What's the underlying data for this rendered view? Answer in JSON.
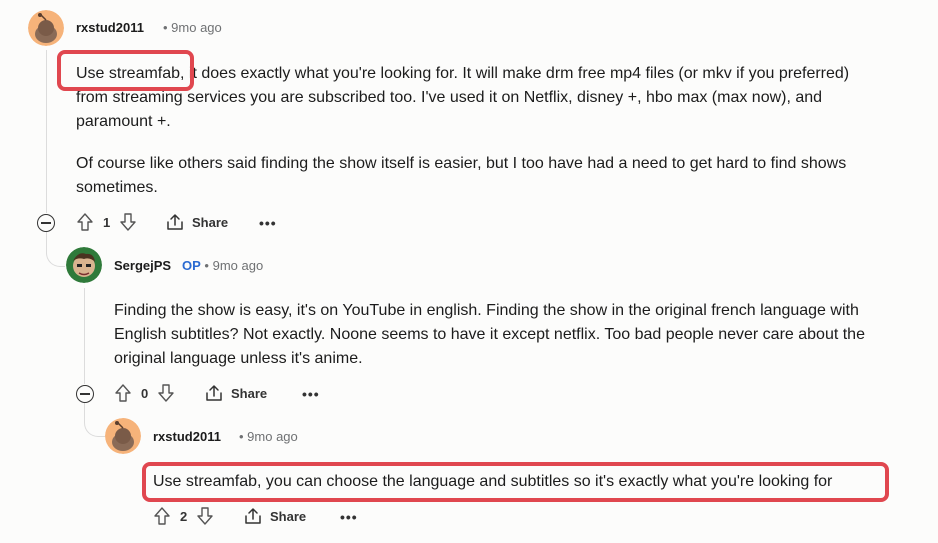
{
  "comments": [
    {
      "author": "rxstud2011",
      "time": "• 9mo ago",
      "paragraph1_lines": [
        "Use streamfab, it does exactly what you're looking for. It will make drm free mp4 files (or mkv if you preferred)",
        "from streaming services you are subscribed too. I've used it on Netflix, disney +, hbo max (max now), and",
        "paramount +."
      ],
      "paragraph2_lines": [
        "Of course like others said finding the show itself is easier, but I too have had a need to get hard to find shows",
        "sometimes."
      ],
      "votes": "1",
      "share_label": "Share",
      "more_label": "•••"
    },
    {
      "author": "SergejPS",
      "op_badge": "OP",
      "time": "• 9mo ago",
      "paragraph1_lines": [
        "Finding the show is easy, it's on YouTube in english. Finding the show in the original french language with",
        "English subtitles? Not exactly. Noone seems to have it except netflix. Too bad people never care about the",
        "original language unless it's anime."
      ],
      "votes": "0",
      "share_label": "Share",
      "more_label": "•••"
    },
    {
      "author": "rxstud2011",
      "time": "• 9mo ago",
      "paragraph1_lines": [
        "Use streamfab, you can choose the language and subtitles so it's exactly what you're looking for"
      ],
      "votes": "2",
      "share_label": "Share",
      "more_label": "•••"
    }
  ],
  "colors": {
    "highlight": "#e0474f",
    "op": "#2a6ad1",
    "meta": "#6f7173",
    "avatar_bg": "#f6b37a"
  }
}
